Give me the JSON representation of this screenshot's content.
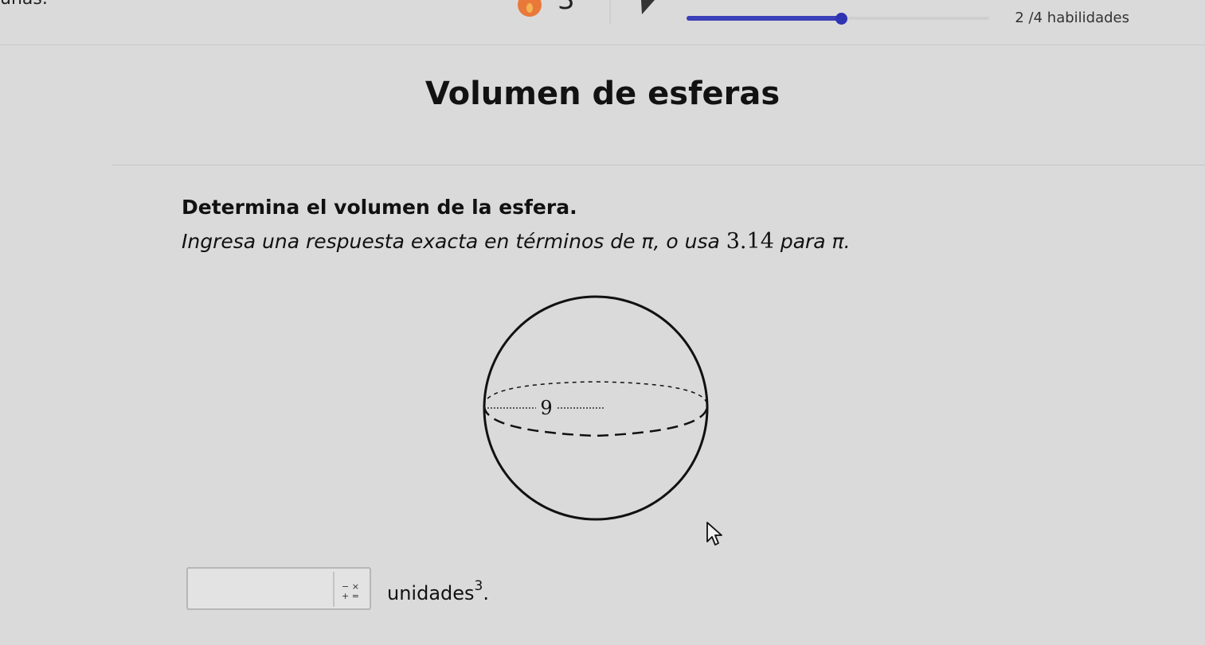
{
  "header": {
    "cut_text": "unas.",
    "streak_count": "3",
    "progress_fraction": 0.51,
    "skills_done": "2",
    "skills_total_label": "/4 habilidades",
    "accent_color": "#3b3fb8"
  },
  "problem": {
    "title": "Volumen de esferas",
    "prompt": "Determina el volumen de la esfera.",
    "instruction_before": "Ingresa una respuesta exacta en términos de π, o usa",
    "instruction_number": "3.14",
    "instruction_after": "para π.",
    "figure": {
      "radius_label": "9"
    }
  },
  "answer": {
    "value": "",
    "units_label": "unidades",
    "units_exponent": "3",
    "units_trailing": "."
  }
}
